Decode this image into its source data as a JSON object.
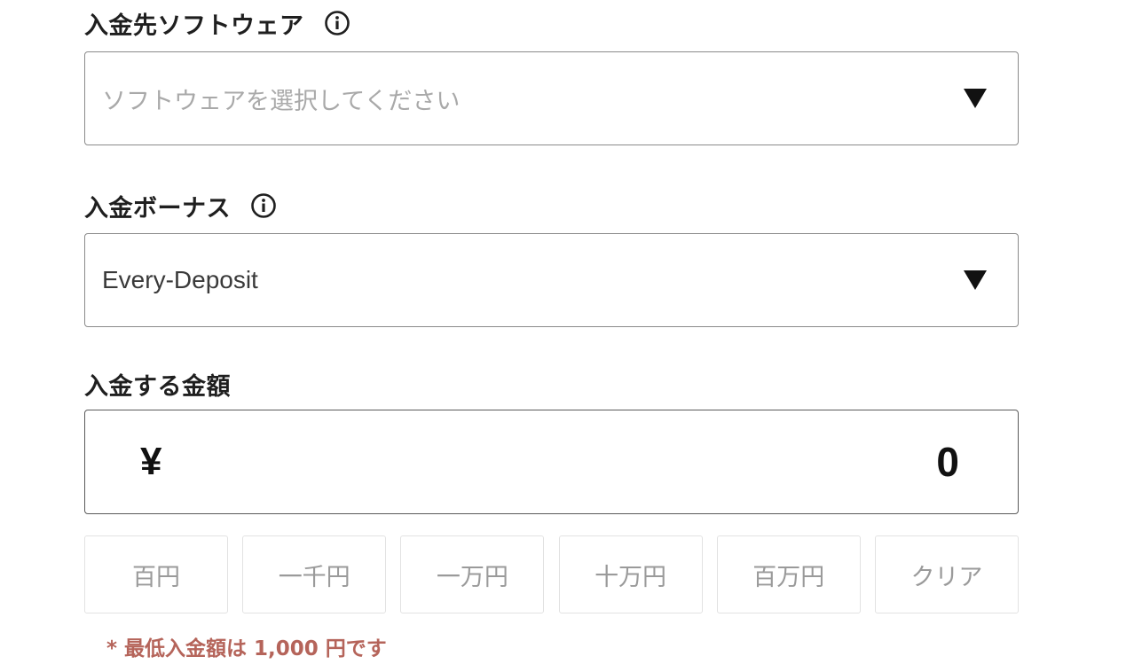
{
  "software": {
    "label": "入金先ソフトウェア",
    "info_icon": "info-circle-icon",
    "placeholder": "ソフトウェアを選択してください",
    "caret_icon": "triangle-down-icon"
  },
  "bonus": {
    "label": "入金ボーナス",
    "info_icon": "info-circle-icon",
    "value": "Every-Deposit",
    "caret_icon": "triangle-down-icon"
  },
  "amount": {
    "label": "入金する金額",
    "currency_symbol": "¥",
    "value": "0"
  },
  "quick_buttons": [
    "百円",
    "一千円",
    "一万円",
    "十万円",
    "百万円",
    "クリア"
  ],
  "note": "* 最低入金額は 1,000 円です",
  "colors": {
    "note": "#b5645a",
    "border": "#8a8a8a",
    "placeholder": "#a9a9a9"
  }
}
